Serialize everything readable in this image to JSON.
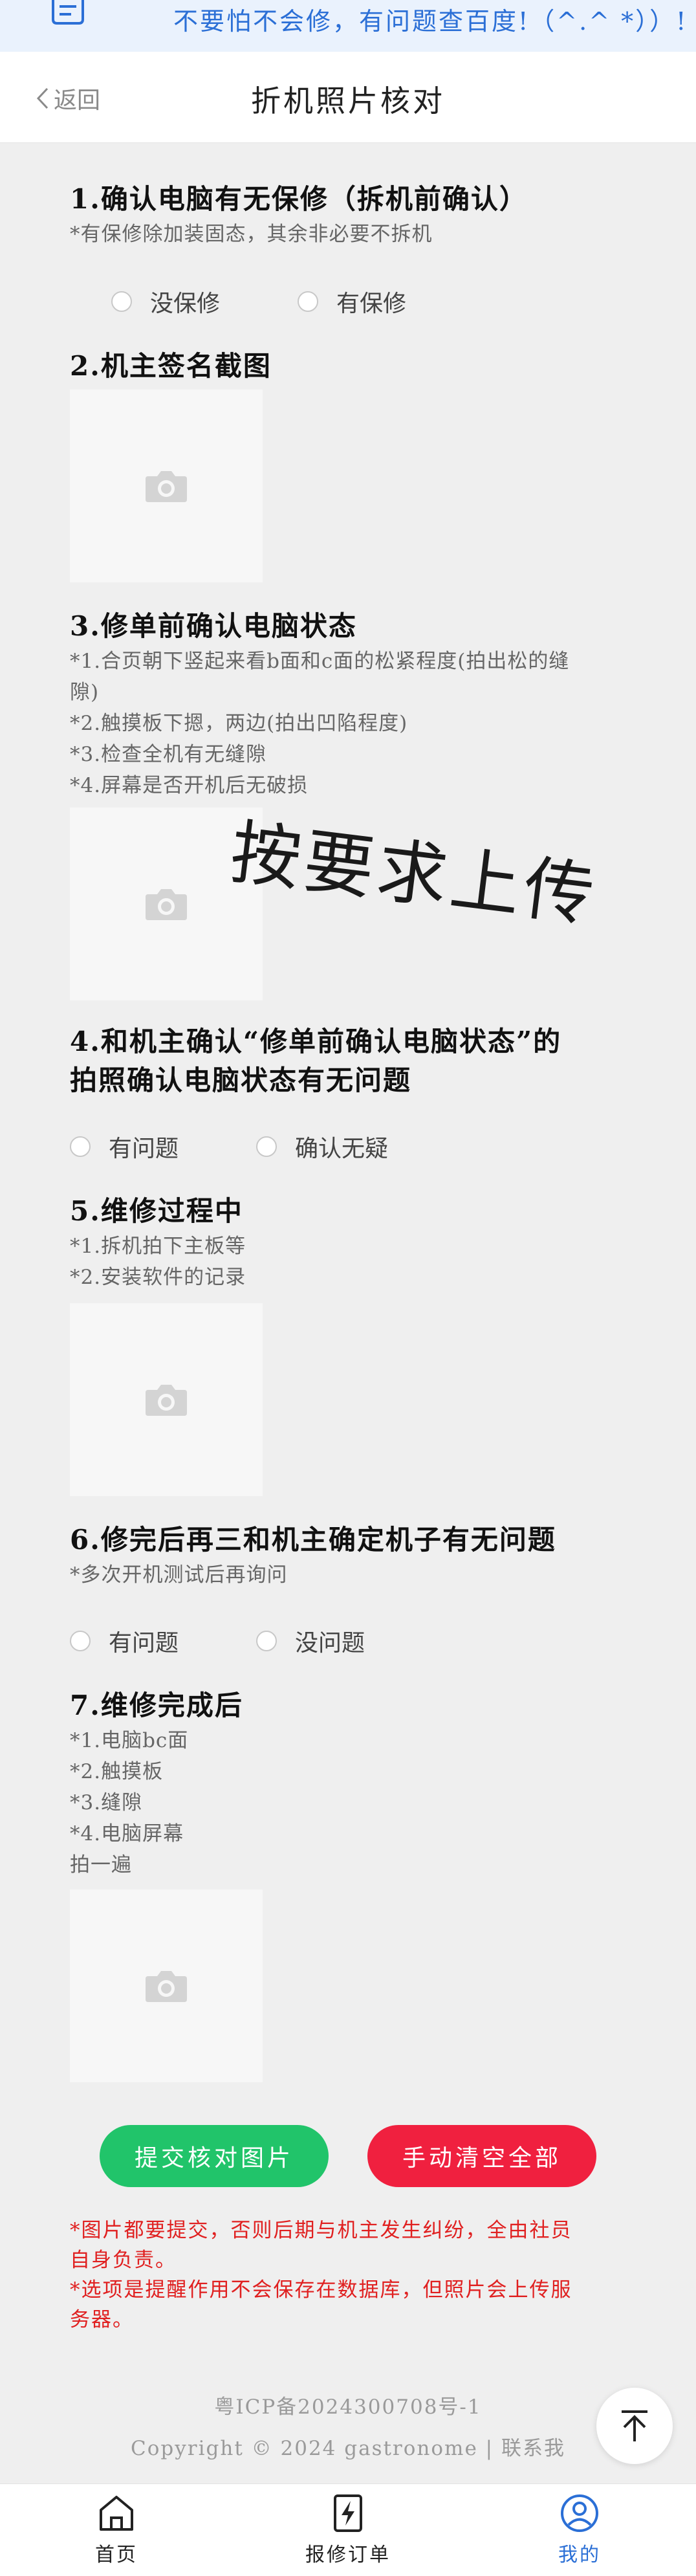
{
  "topbar": {
    "notice": "不要怕不会修，有问题查百度!（^.^ *））!"
  },
  "navbar": {
    "back_label": "返回",
    "title": "折机照片核对"
  },
  "sections": [
    {
      "title": "1.确认电脑有无保修（拆机前确认）",
      "notes": [
        "*有保修除加装固态，其余非必要不拆机"
      ],
      "options": [
        "没保修",
        "有保修"
      ]
    },
    {
      "title": "2.机主签名截图"
    },
    {
      "title": "3.修单前确认电脑状态",
      "notes": [
        "*1.合页朝下竖起来看b面和c面的松紧程度(拍出松的缝",
        "隙)",
        "*2.触摸板下摁，两边(拍出凹陷程度)",
        "*3.检查全机有无缝隙",
        "*4.屏幕是否开机后无破损"
      ]
    },
    {
      "title_line1": "4.和机主确认“修单前确认电脑状态”的",
      "title_line2": "拍照确认电脑状态有无问题",
      "options": [
        "有问题",
        "确认无疑"
      ]
    },
    {
      "title": "5.维修过程中",
      "notes": [
        "*1.拆机拍下主板等",
        "*2.安装软件的记录"
      ]
    },
    {
      "title": "6.修完后再三和机主确定机子有无问题",
      "notes": [
        "*多次开机测试后再询问"
      ],
      "options": [
        "有问题",
        "没问题"
      ]
    },
    {
      "title": "7.维修完成后",
      "notes": [
        "*1.电脑bc面",
        "*2.触摸板",
        "*3.缝隙",
        "*4.电脑屏幕",
        "拍一遍"
      ]
    }
  ],
  "watermark": "按要求上传",
  "buttons": {
    "submit": "提交核对图片",
    "clear": "手动清空全部"
  },
  "warnings": [
    "*图片都要提交，否则后期与机主发生纠纷，全由社员",
    "自身负责。",
    "*选项是提醒作用不会保存在数据库，但照片会上传服",
    "务器。"
  ],
  "footer": {
    "icp": "粤ICP备2024300708号-1",
    "copyright": "Copyright © 2024 gastronome | 联系我"
  },
  "tabbar": {
    "home": "首页",
    "orders": "报修订单",
    "mine": "我的"
  },
  "colors": {
    "accent": "#2b6fd6",
    "submit": "#21c46a",
    "clear": "#f0203f",
    "warning": "#e02020"
  },
  "icons": [
    "document-icon",
    "chevron-left-icon",
    "camera-icon",
    "arrow-up-icon",
    "home-icon",
    "flash-doc-icon",
    "user-icon"
  ]
}
